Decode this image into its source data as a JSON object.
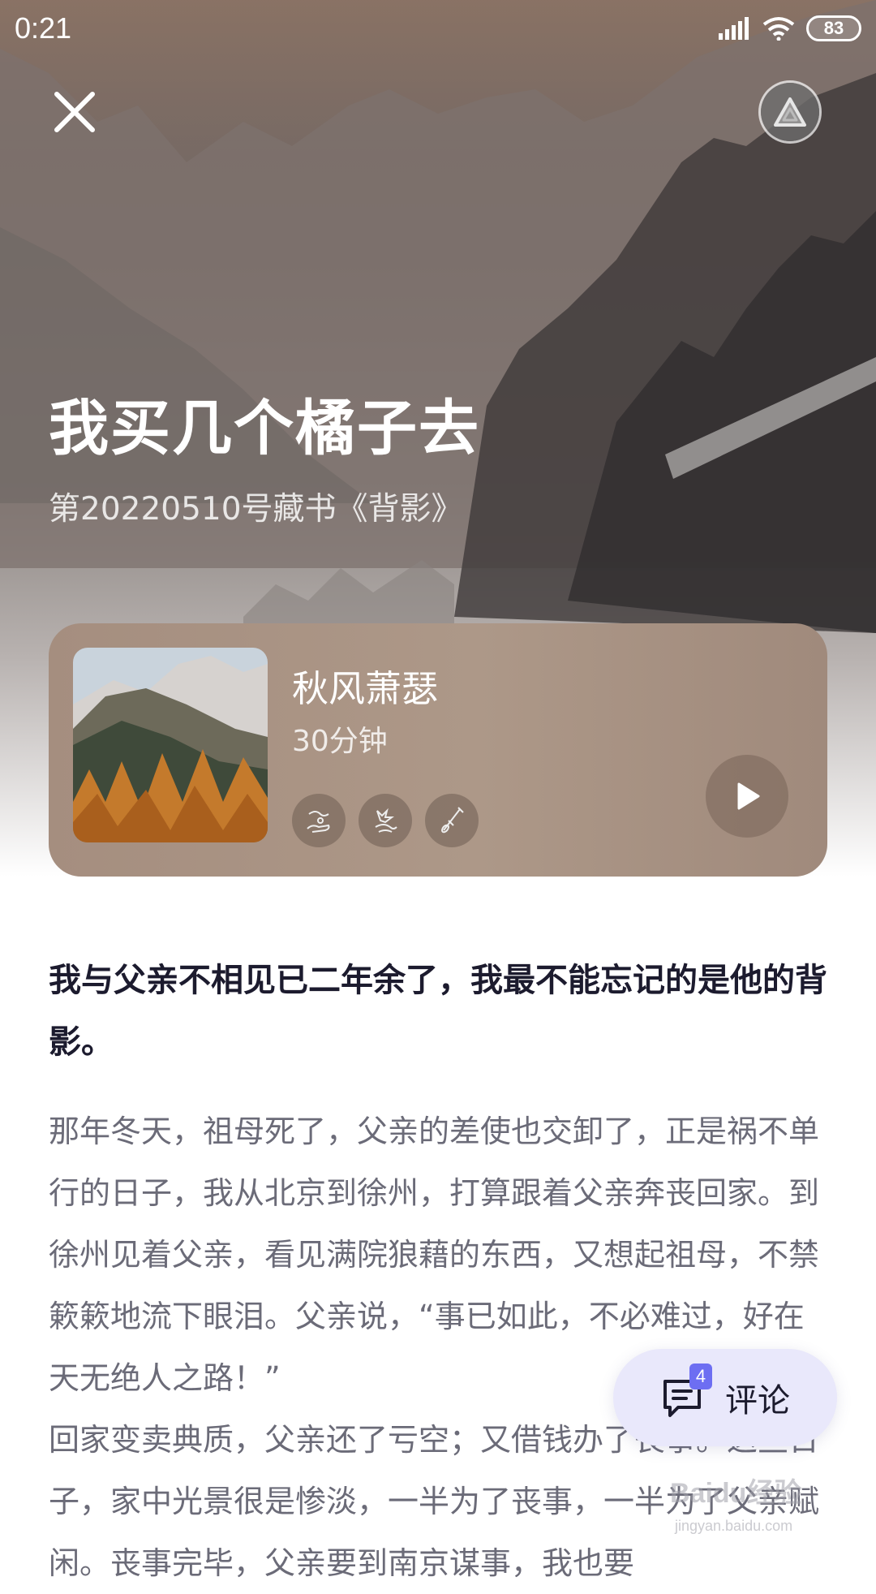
{
  "status_bar": {
    "time": "0:21",
    "battery": "83",
    "icons": [
      "signal-icon",
      "wifi-icon",
      "battery-icon"
    ]
  },
  "header": {
    "close_icon": "close-icon",
    "top_right_icon": "triangle-icon"
  },
  "hero": {
    "title": "我买几个橘子去",
    "subtitle": "第20220510号藏书《背影》"
  },
  "audio_card": {
    "title": "秋风萧瑟",
    "duration": "30分钟",
    "tags": [
      "wind-hand-icon",
      "leaf-wind-icon",
      "instrument-icon"
    ],
    "play_icon": "play-icon"
  },
  "article": {
    "lead": "我与父亲不相见已二年余了，我最不能忘记的是他的背影。",
    "paragraphs": [
      "那年冬天，祖母死了，父亲的差使也交卸了，正是祸不单行的日子，我从北京到徐州，打算跟着父亲奔丧回家。到徐州见着父亲，看见满院狼藉的东西，又想起祖母，不禁簌簌地流下眼泪。父亲说，“事已如此，不必难过，好在天无绝人之路！”",
      "回家变卖典质，父亲还了亏空；又借钱办了丧事。这些日子，家中光景很是惨淡，一半为了丧事，一半为了父亲赋闲。丧事完毕，父亲要到南京谋事，我也要"
    ]
  },
  "comment_button": {
    "label": "评论",
    "count": "4",
    "icon": "comment-icon"
  },
  "watermark": {
    "text": "Baidu经验",
    "sub": "jingyan.baidu.com"
  },
  "colors": {
    "card_bg": "#a58e7f",
    "title_text": "#1c1b2e",
    "body_text": "#6b6b78",
    "comment_bg": "#e9e8fb",
    "badge": "#6d6ef2"
  }
}
